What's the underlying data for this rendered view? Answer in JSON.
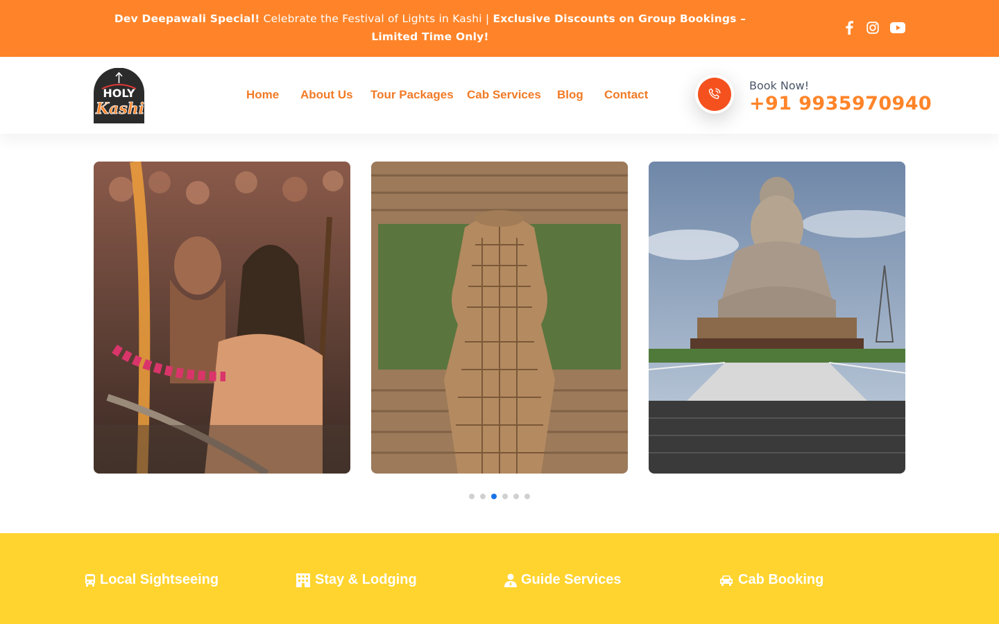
{
  "announcement": {
    "lead": "Dev Deepawali Special!",
    "middle": " Celebrate the Festival of Lights in Kashi | ",
    "tail": "Exclusive Discounts on Group Bookings – Limited Time Only!"
  },
  "social": [
    {
      "name": "facebook",
      "icon": "facebook-icon"
    },
    {
      "name": "instagram",
      "icon": "instagram-icon"
    },
    {
      "name": "youtube",
      "icon": "youtube-icon"
    }
  ],
  "logo": {
    "line1": "HOLY",
    "line2": "Kashi"
  },
  "nav": [
    {
      "label": "Home"
    },
    {
      "label": "About Us"
    },
    {
      "label": "Tour Packages"
    },
    {
      "label": "Cab Services"
    },
    {
      "label": "Blog"
    },
    {
      "label": "Contact"
    }
  ],
  "booking": {
    "label": "Book Now!",
    "phone": "+91 9935970940",
    "icon": "phone-icon"
  },
  "carousel": {
    "slides": [
      {
        "alt": "sadhus-at-ghat"
      },
      {
        "alt": "carved-stone-temple"
      },
      {
        "alt": "great-buddha-statue"
      }
    ],
    "dot_count": 6,
    "active_dot": 2
  },
  "services": [
    {
      "label": "Local Sightseeing",
      "icon": "bus-icon"
    },
    {
      "label": "Stay & Lodging",
      "icon": "hotel-icon"
    },
    {
      "label": "Guide Services",
      "icon": "guide-icon"
    },
    {
      "label": "Cab Booking",
      "icon": "car-icon"
    }
  ],
  "colors": {
    "topbar": "#ff8429",
    "nav_text": "#f07a26",
    "phone_text": "#ff8429",
    "call_button": "#f4511e",
    "services_band": "#ffd42e",
    "dot_active": "#1a73e8"
  }
}
